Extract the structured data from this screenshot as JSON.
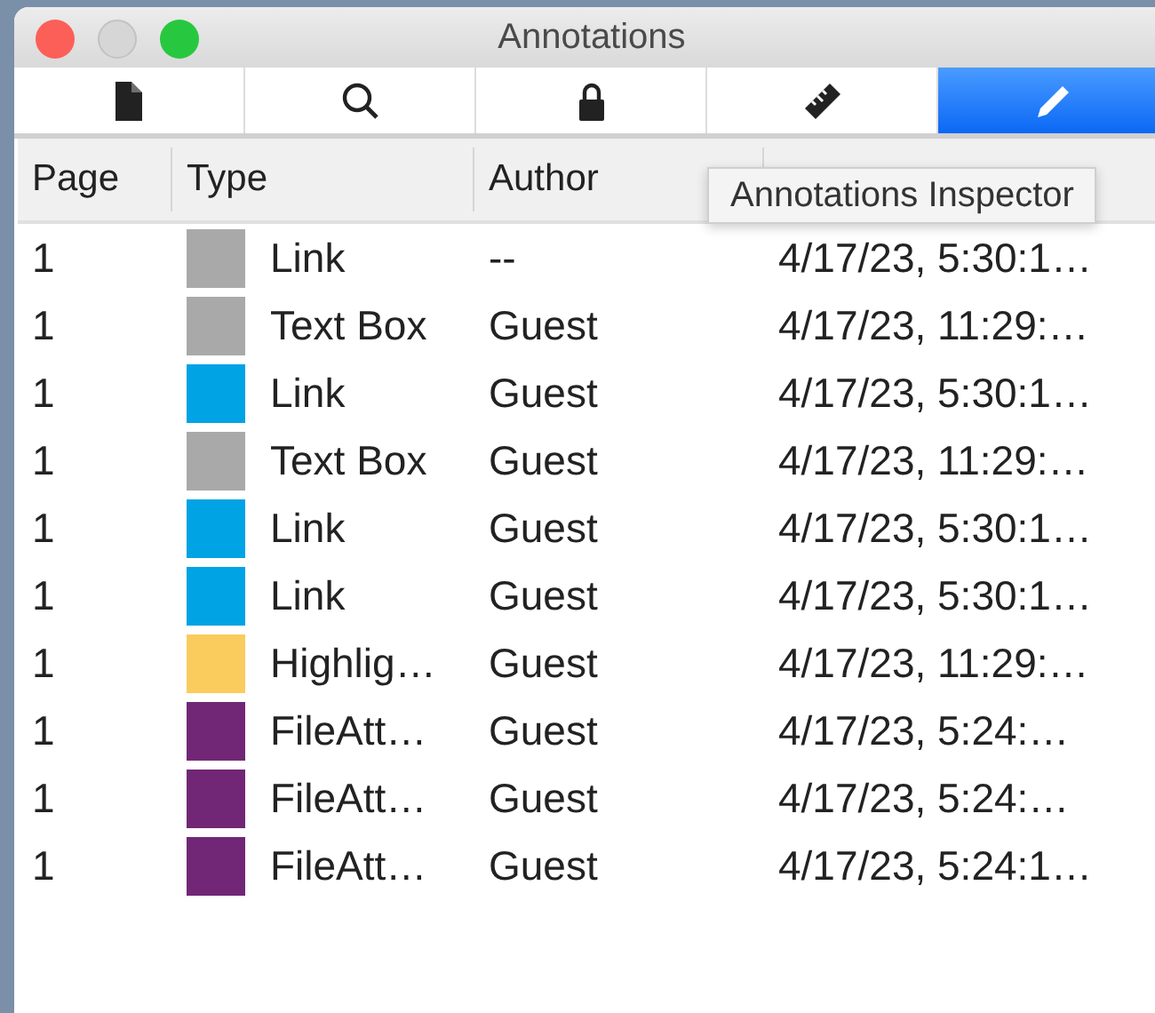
{
  "window": {
    "title": "Annotations"
  },
  "toolbar": [
    {
      "kind": "document",
      "selected": false
    },
    {
      "kind": "search",
      "selected": false
    },
    {
      "kind": "lock",
      "selected": false
    },
    {
      "kind": "ruler",
      "selected": false
    },
    {
      "kind": "pencil",
      "selected": true
    }
  ],
  "table": {
    "columns": [
      "Page",
      "Type",
      "Author"
    ],
    "rows": [
      {
        "page": "1",
        "color": "#a9a9a9",
        "type": "Link",
        "author": "--",
        "date": "4/17/23, 5:30:1…"
      },
      {
        "page": "1",
        "color": "#a9a9a9",
        "type": "Text Box",
        "author": "Guest",
        "date": "4/17/23, 11:29:…"
      },
      {
        "page": "1",
        "color": "#00a3e4",
        "type": "Link",
        "author": "Guest",
        "date": "4/17/23, 5:30:1…"
      },
      {
        "page": "1",
        "color": "#a9a9a9",
        "type": "Text Box",
        "author": "Guest",
        "date": "4/17/23, 11:29:…"
      },
      {
        "page": "1",
        "color": "#00a3e4",
        "type": "Link",
        "author": "Guest",
        "date": "4/17/23, 5:30:1…"
      },
      {
        "page": "1",
        "color": "#00a3e4",
        "type": "Link",
        "author": "Guest",
        "date": "4/17/23, 5:30:1…"
      },
      {
        "page": "1",
        "color": "#f9cc5d",
        "type": "Highlig…",
        "author": "Guest",
        "date": "4/17/23, 11:29:…"
      },
      {
        "page": "1",
        "color": "#712776",
        "type": "FileAtt…",
        "author": "Guest",
        "date": "4/17/23, 5:24:…"
      },
      {
        "page": "1",
        "color": "#712776",
        "type": "FileAtt…",
        "author": "Guest",
        "date": "4/17/23, 5:24:…"
      },
      {
        "page": "1",
        "color": "#712776",
        "type": "FileAtt…",
        "author": "Guest",
        "date": "4/17/23, 5:24:1…"
      }
    ]
  },
  "tooltip": {
    "text": "Annotations Inspector"
  }
}
